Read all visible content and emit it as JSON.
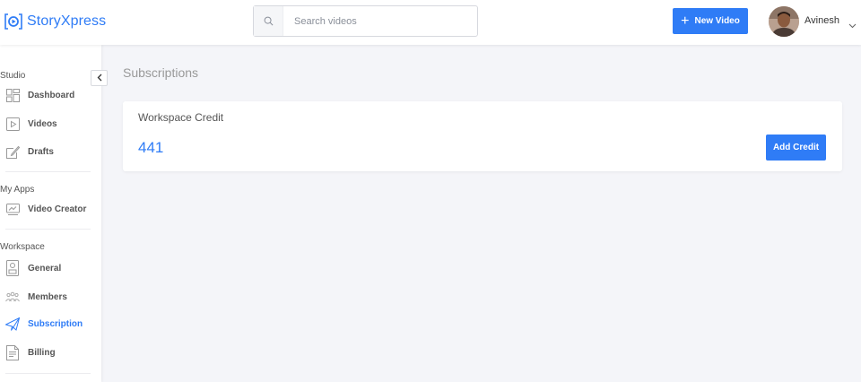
{
  "brand": {
    "name": "StoryXpress",
    "accent": "#2f7cf6"
  },
  "header": {
    "search": {
      "placeholder": "Search videos",
      "value": ""
    },
    "new_video_label": "New Video",
    "user": {
      "name": "Avinesh"
    }
  },
  "sidebar": {
    "sections": [
      {
        "label": "Studio",
        "items": [
          {
            "label": "Dashboard",
            "icon": "dashboard-icon"
          },
          {
            "label": "Videos",
            "icon": "video-icon"
          },
          {
            "label": "Drafts",
            "icon": "draft-icon"
          }
        ]
      },
      {
        "label": "My Apps",
        "items": [
          {
            "label": "Video Creator",
            "icon": "video-creator-icon"
          }
        ]
      },
      {
        "label": "Workspace",
        "items": [
          {
            "label": "General",
            "icon": "general-icon"
          },
          {
            "label": "Members",
            "icon": "members-icon"
          },
          {
            "label": "Subscription",
            "icon": "subscription-icon",
            "active": true
          },
          {
            "label": "Billing",
            "icon": "billing-icon"
          }
        ]
      }
    ]
  },
  "main": {
    "page_title": "Subscriptions",
    "credit_card": {
      "label": "Workspace Credit",
      "value": "441",
      "button_label": "Add Credit"
    }
  }
}
